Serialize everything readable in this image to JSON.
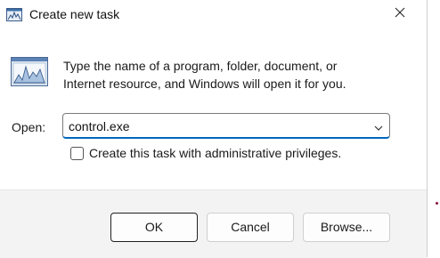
{
  "window": {
    "title": "Create new task",
    "title_icon": "run-app-icon",
    "close_icon": "close-icon"
  },
  "content": {
    "icon": "run-app-icon",
    "description_line1": "Type the name of a program, folder, document, or",
    "description_line2": "Internet resource, and Windows will open it for you."
  },
  "open_field": {
    "label": "Open:",
    "value": "control.exe",
    "dropdown_icon": "chevron-down-icon"
  },
  "admin_option": {
    "label": "Create this task with administrative privileges.",
    "checked": false
  },
  "buttons": {
    "ok": "OK",
    "cancel": "Cancel",
    "browse": "Browse..."
  },
  "colors": {
    "accent": "#0067c0",
    "footer_bg": "#f3f3f3"
  }
}
